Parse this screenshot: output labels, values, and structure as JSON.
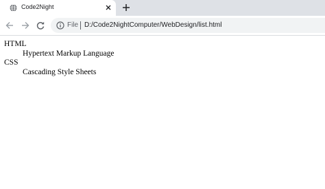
{
  "tab": {
    "title": "Code2Night",
    "favicon_icon": "globe-icon",
    "close_icon": "close-icon"
  },
  "new_tab_icon": "plus-icon",
  "toolbar": {
    "back_icon": "arrow-left-icon",
    "forward_icon": "arrow-right-icon",
    "reload_icon": "reload-icon",
    "info_icon": "info-icon",
    "scheme_label": "File",
    "url": "D:/Code2NightComputer/WebDesign/list.html"
  },
  "colors": {
    "tabstrip_bg": "#dee1e6",
    "omnibox_bg": "#f1f3f4",
    "icon_gray": "#5f6368",
    "text_dark": "#202124"
  },
  "page": {
    "definition_list": [
      {
        "term": "HTML",
        "definition": "Hypertext Markup Language"
      },
      {
        "term": "CSS",
        "definition": "Cascading Style Sheets"
      }
    ]
  }
}
